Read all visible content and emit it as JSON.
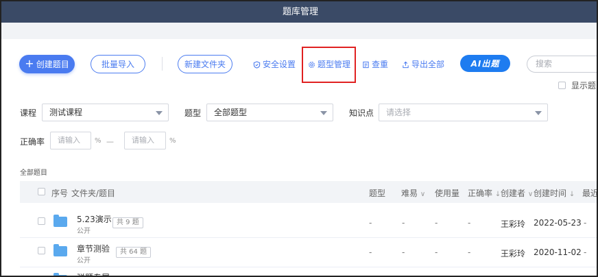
{
  "window": {
    "title": "题库管理"
  },
  "toolbar": {
    "create_label": "创建题目",
    "batch_import_label": "批量导入",
    "new_folder_label": "新建文件夹",
    "security_label": "安全设置",
    "type_manage_label": "题型管理",
    "dedupe_label": "查重",
    "export_all_label": "导出全部",
    "ai_label": "AI出题",
    "search_placeholder": "搜索",
    "show_label": "显示题目"
  },
  "filters": {
    "course_label": "课程",
    "course_value": "测试课程",
    "type_label": "题型",
    "type_value": "全部题型",
    "knowledge_label": "知识点",
    "knowledge_placeholder": "请选择",
    "accuracy_label": "正确率",
    "accuracy_min_placeholder": "请输入",
    "accuracy_max_placeholder": "请输入",
    "percent": "%",
    "range_sep": "—"
  },
  "section": {
    "label": "全部题目"
  },
  "table": {
    "headers": {
      "index": "序号",
      "name": "文件夹/题目",
      "type": "题型",
      "difficulty": "难易",
      "usage": "使用量",
      "accuracy": "正确率",
      "creator": "创建者",
      "created": "创建时间",
      "recent": "最近"
    },
    "rows": [
      {
        "name": "5.23演示",
        "visibility": "公开",
        "count": "共 9 题",
        "type": "-",
        "difficulty": "-",
        "usage": "-",
        "accuracy": "-",
        "creator": "王彩玲",
        "created": "2022-05-23",
        "recent": "-"
      },
      {
        "name": "章节测验",
        "visibility": "公开",
        "count": "共 64 题",
        "type": "-",
        "difficulty": "-",
        "usage": "-",
        "accuracy": "-",
        "creator": "王彩玲",
        "created": "2020-11-02",
        "recent": "-"
      },
      {
        "name": "弹题专属"
      }
    ]
  }
}
